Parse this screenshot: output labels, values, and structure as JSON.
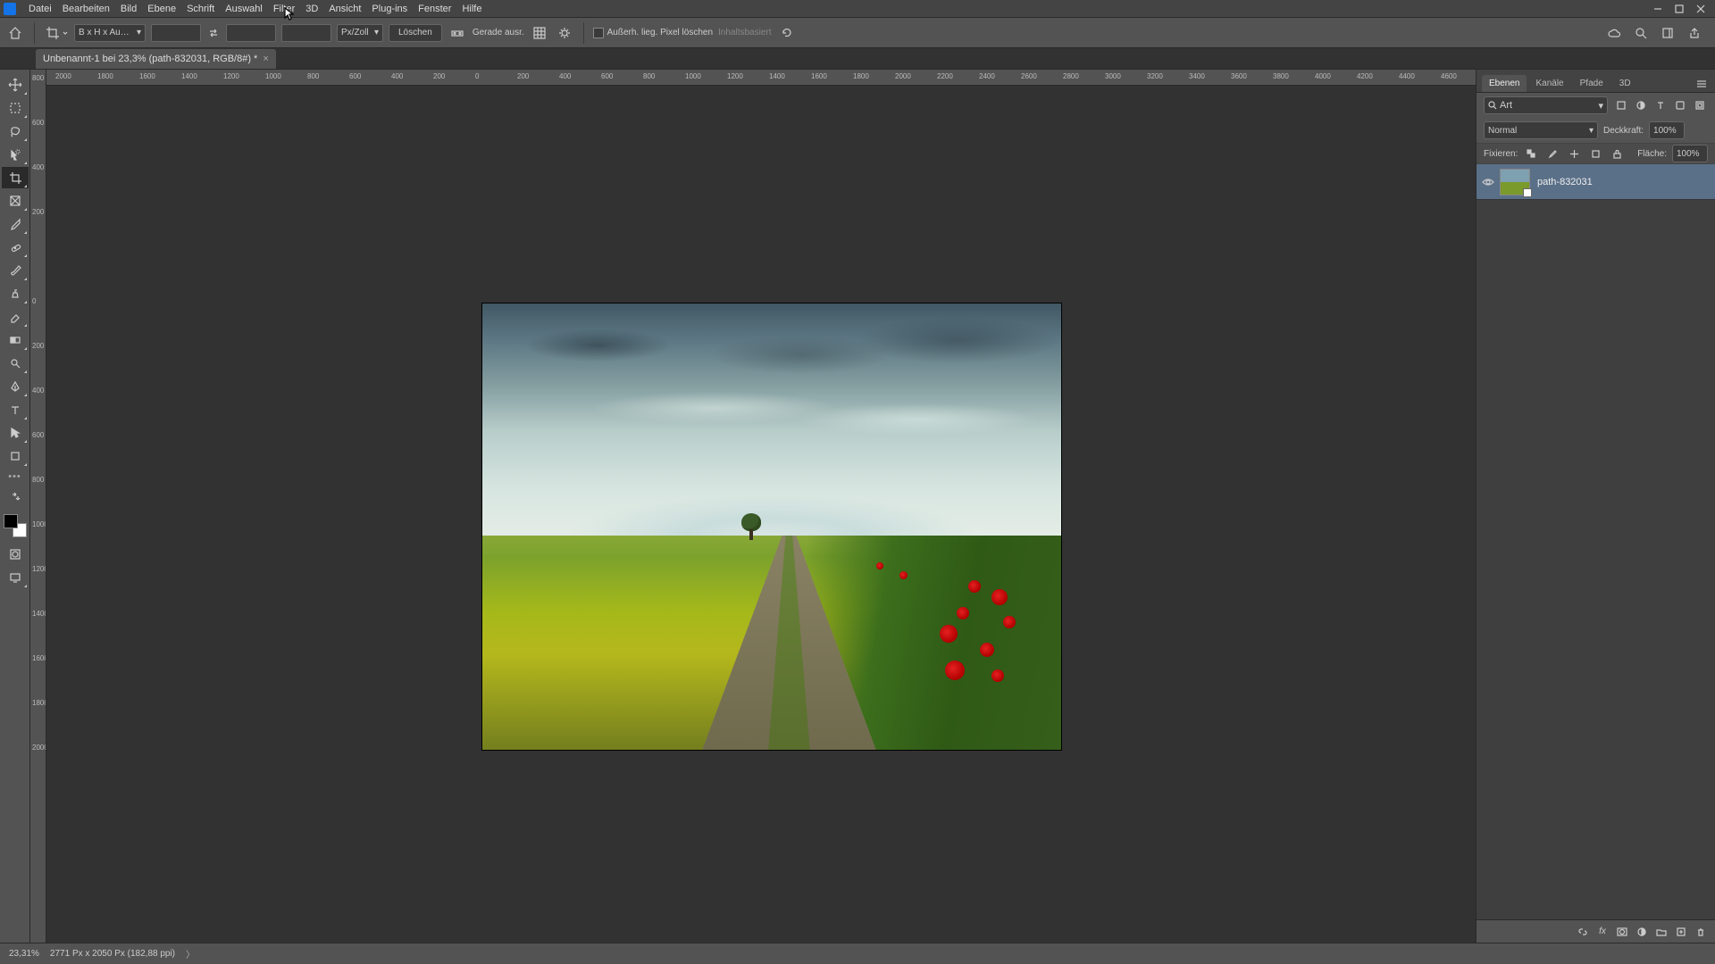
{
  "menubar": [
    "Datei",
    "Bearbeiten",
    "Bild",
    "Ebene",
    "Schrift",
    "Auswahl",
    "Filter",
    "3D",
    "Ansicht",
    "Plug-ins",
    "Fenster",
    "Hilfe"
  ],
  "options": {
    "preset": "B x H x Au…",
    "unit": "Px/Zoll",
    "clear": "Löschen",
    "straighten": "Gerade ausr.",
    "delete_cropped": "Außerh. lieg. Pixel löschen",
    "content_aware": "Inhaltsbasiert"
  },
  "doc": {
    "tab": "Unbenannt-1 bei 23,3% (path-832031, RGB/8#) *"
  },
  "ruler_h": [
    "2000",
    "1800",
    "1600",
    "1400",
    "1200",
    "1000",
    "800",
    "600",
    "400",
    "200",
    "0",
    "200",
    "400",
    "600",
    "800",
    "1000",
    "1200",
    "1400",
    "1600",
    "1800",
    "2000",
    "2200",
    "2400",
    "2600",
    "2800",
    "3000",
    "3200",
    "3400",
    "3600",
    "3800",
    "4000",
    "4200",
    "4400",
    "4600"
  ],
  "ruler_v": [
    "0",
    "200",
    "400",
    "600",
    "800",
    "1000",
    "1200",
    "1400",
    "1600",
    "1800",
    "2000"
  ],
  "ruler_v_neg": [
    "200",
    "400",
    "600",
    "800"
  ],
  "panels": {
    "tabs": [
      "Ebenen",
      "Kanäle",
      "Pfade",
      "3D"
    ],
    "search_placeholder": "Art",
    "blend_mode": "Normal",
    "opacity_label": "Deckkraft:",
    "opacity_value": "100%",
    "lock_label": "Fixieren:",
    "fill_label": "Fläche:",
    "fill_value": "100%",
    "layer_name": "path-832031"
  },
  "status": {
    "zoom": "23,31%",
    "dims": "2771 Px x 2050 Px (182,88 ppi)"
  }
}
